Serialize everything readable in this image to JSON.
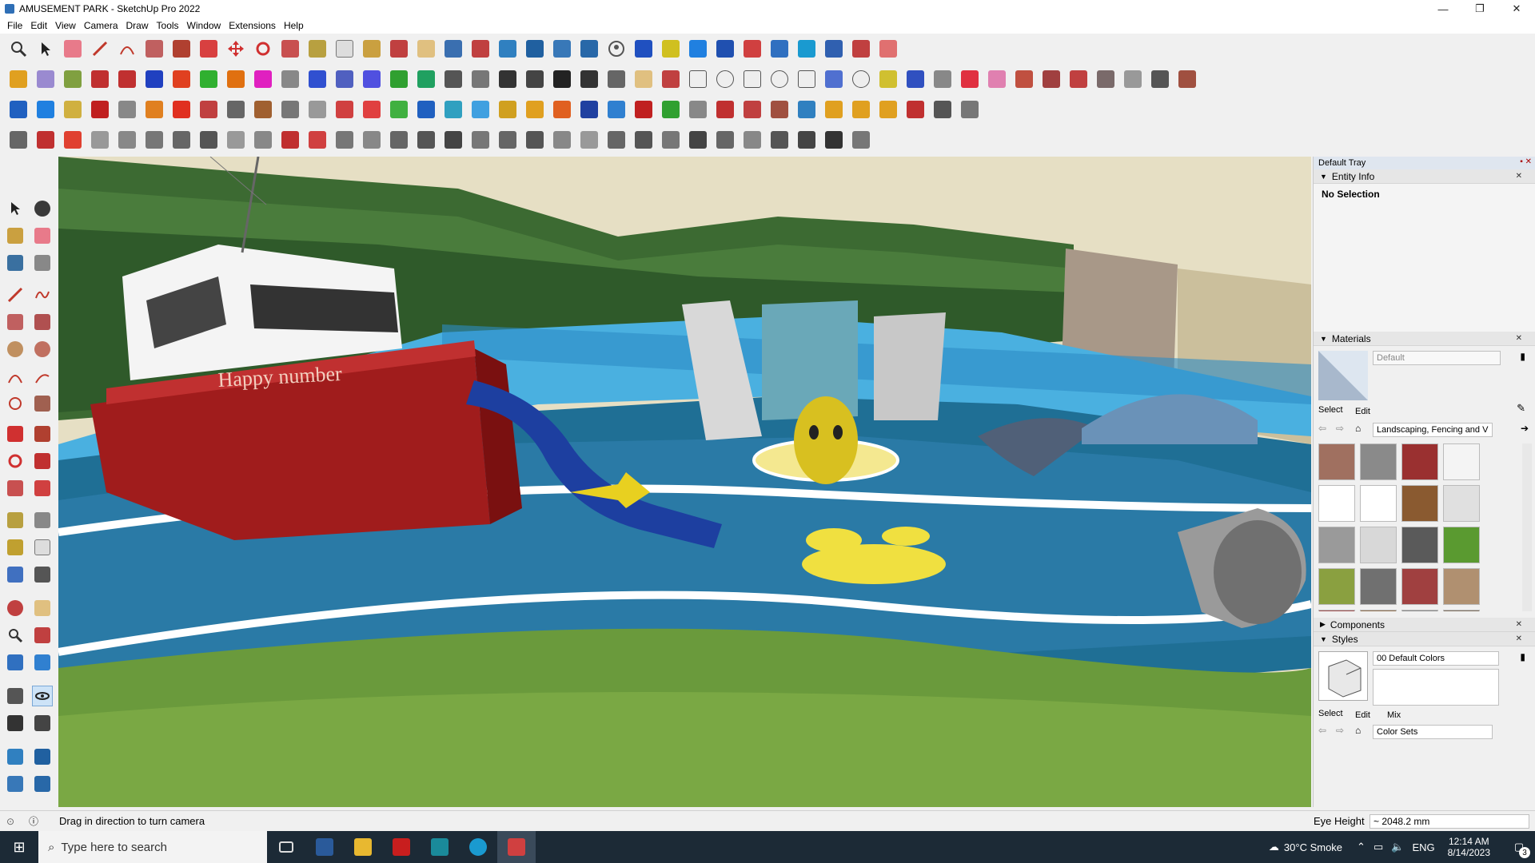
{
  "window": {
    "title": "AMUSEMENT PARK - SketchUp Pro 2022",
    "controls": [
      "—",
      "❐",
      "✕"
    ]
  },
  "menu": [
    "File",
    "Edit",
    "View",
    "Camera",
    "Draw",
    "Tools",
    "Window",
    "Extensions",
    "Help"
  ],
  "scene": {
    "boat_text": "Happy number"
  },
  "tray": {
    "title": "Default Tray",
    "entity_info": {
      "label": "Entity Info",
      "selection": "No Selection"
    },
    "materials": {
      "label": "Materials",
      "name_value": "Default",
      "tabs": [
        "Select",
        "Edit"
      ],
      "collection": "Landscaping, Fencing and V",
      "swatch_colors": [
        "#a07060",
        "#8a8a8a",
        "#9a3030",
        "#f4f4f4",
        "#ffffff",
        "#ffffff",
        "#8a5a30",
        "#e0e0e0",
        "#9a9a9a",
        "#d8d8d8",
        "#5a5a5a",
        "#5a9a30",
        "#8aa040",
        "#707070",
        "#a04040",
        "#b09070",
        "#a05050",
        "#907050",
        "#8a8a8a",
        "#807060",
        "#c08040",
        "#c0a070",
        "#909090",
        "#b07050"
      ]
    },
    "components": {
      "label": "Components"
    },
    "styles": {
      "label": "Styles",
      "name_value": "00  Default Colors",
      "tabs": [
        "Select",
        "Edit",
        "Mix"
      ],
      "collection": "Color Sets"
    }
  },
  "status": {
    "message": "Drag in direction to turn camera",
    "eye_height_label": "Eye Height",
    "eye_height_value": "~ 2048.2 mm"
  },
  "taskbar": {
    "search_placeholder": "Type here to search",
    "weather": "30°C  Smoke",
    "language": "ENG",
    "time": "12:14 AM",
    "date": "8/14/2023",
    "notification_count": "3"
  }
}
